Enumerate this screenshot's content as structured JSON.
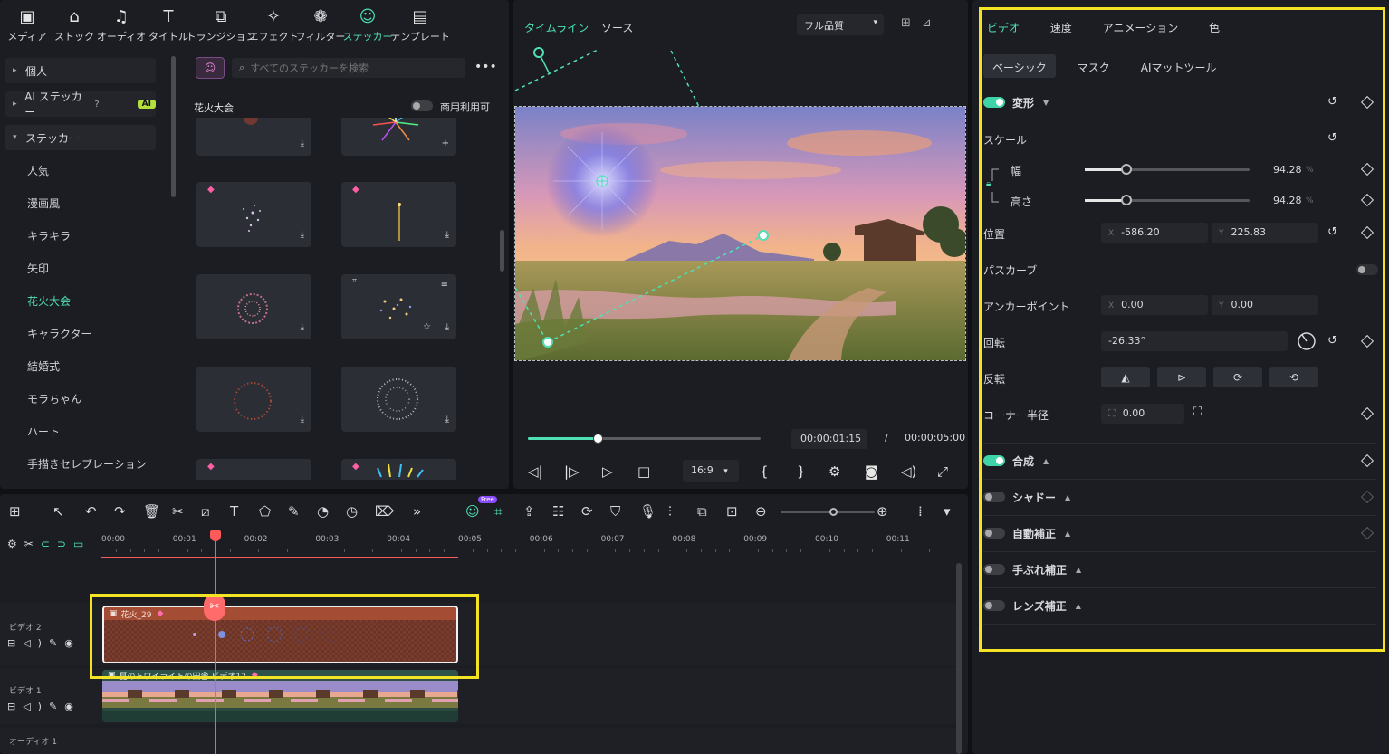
{
  "tool_tabs": [
    {
      "label": "メディア",
      "icon": "media-icon",
      "glyph": "▣"
    },
    {
      "label": "ストック",
      "icon": "stock-icon",
      "glyph": "⌂"
    },
    {
      "label": "オーディオ",
      "icon": "audio-icon",
      "glyph": "♫"
    },
    {
      "label": "タイトル",
      "icon": "title-icon",
      "glyph": "T"
    },
    {
      "label": "トランジション",
      "icon": "transition-icon",
      "glyph": "⧉"
    },
    {
      "label": "エフェクト",
      "icon": "effect-icon",
      "glyph": "✧"
    },
    {
      "label": "フィルター",
      "icon": "filter-icon",
      "glyph": "❁"
    },
    {
      "label": "ステッカー",
      "icon": "sticker-icon",
      "glyph": "☺"
    },
    {
      "label": "テンプレート",
      "icon": "template-icon",
      "glyph": "▤"
    }
  ],
  "left_nav": {
    "groups": [
      {
        "label": "個人",
        "caret": "▸"
      },
      {
        "label": "AI ステッカー",
        "caret": "▸",
        "badge": "AI",
        "help": "?"
      },
      {
        "label": "ステッカー",
        "caret": "▾"
      }
    ],
    "items": [
      "人気",
      "漫画風",
      "キラキラ",
      "矢印",
      "花火大会",
      "キャラクター",
      "結婚式",
      "モラちゃん",
      "ハート",
      "手描きセレブレーション"
    ],
    "active_item": "花火大会"
  },
  "sticker_panel": {
    "search_placeholder": "すべてのステッカーを検索",
    "section_title": "花火大会",
    "commercial_label": "商用利用可",
    "commercial_on": false
  },
  "preview": {
    "tabs": [
      "タイムライン",
      "ソース"
    ],
    "quality": "フル品質",
    "current_time": "00:00:01:15",
    "separator": "/",
    "duration": "00:00:05:00",
    "progress": 0.3,
    "ratio": "16:9"
  },
  "right_panel": {
    "tabs": [
      "ビデオ",
      "速度",
      "アニメーション",
      "色"
    ],
    "subtabs": [
      "ベーシック",
      "マスク",
      "AIマットツール"
    ],
    "transform": {
      "title": "変形",
      "scale_label": "スケール",
      "width_label": "幅",
      "width_value": "94.28",
      "height_label": "高さ",
      "height_value": "94.28",
      "unit": "%",
      "scale_fraction": 0.25,
      "position_label": "位置",
      "pos_x": "-586.20",
      "pos_y": "225.83",
      "path_curve_label": "パスカーブ",
      "anchor_label": "アンカーポイント",
      "anchor_x": "0.00",
      "anchor_y": "0.00",
      "rotate_label": "回転",
      "rotate_value": "-26.33°",
      "flip_label": "反転",
      "corner_label": "コーナー半径",
      "corner_value": "0.00",
      "axis_x": "X",
      "axis_y": "Y"
    },
    "sections": [
      {
        "label": "合成",
        "on": true
      },
      {
        "label": "シャドー",
        "on": false
      },
      {
        "label": "自動補正",
        "on": false
      },
      {
        "label": "手ぶれ補正",
        "on": false
      },
      {
        "label": "レンズ補正",
        "on": false
      }
    ]
  },
  "timeline": {
    "ruler": [
      "00:00",
      "00:01",
      "00:02",
      "00:03",
      "00:04",
      "00:05",
      "00:06",
      "00:07",
      "00:08",
      "00:09",
      "00:10",
      "00:11"
    ],
    "tracks": [
      {
        "label": "ビデオ 2"
      },
      {
        "label": "ビデオ 1"
      },
      {
        "label": "オーディオ 1"
      }
    ],
    "clip_sticker": "花火_29",
    "clip_video": "夏のトワイライトの田舎 ビデオ12",
    "free_badge": "Free"
  },
  "colors": {
    "accent": "#4fe0b8",
    "highlight": "#f2e424",
    "playhead": "#ff5a5a",
    "clip_sticker": "#8a3f2c"
  }
}
